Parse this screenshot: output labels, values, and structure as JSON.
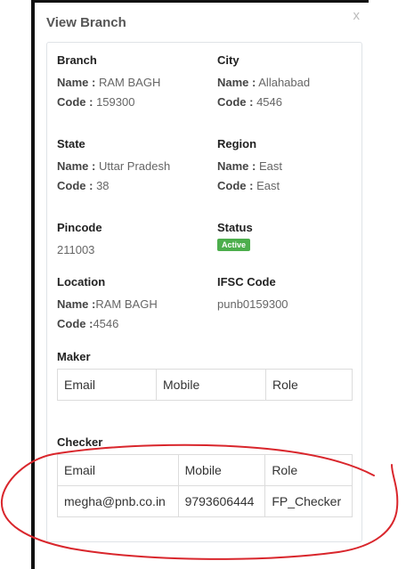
{
  "modal": {
    "title": "View Branch",
    "close": "x"
  },
  "branch": {
    "label": "Branch",
    "name_key": "Name :",
    "name_value": "RAM BAGH",
    "code_key": "Code :",
    "code_value": "159300"
  },
  "city": {
    "label": "City",
    "name_key": "Name :",
    "name_value": "Allahabad",
    "code_key": "Code :",
    "code_value": "4546"
  },
  "state": {
    "label": "State",
    "name_key": "Name :",
    "name_value": "Uttar Pradesh",
    "code_key": "Code :",
    "code_value": "38"
  },
  "region": {
    "label": "Region",
    "name_key": "Name :",
    "name_value": "East",
    "code_key": "Code :",
    "code_value": "East"
  },
  "pincode": {
    "label": "Pincode",
    "value": "211003"
  },
  "status": {
    "label": "Status",
    "badge": "Active",
    "badge_color": "#4cae4c"
  },
  "location": {
    "label": "Location",
    "name_key": "Name :",
    "name_value": "RAM BAGH",
    "code_key": "Code :",
    "code_value": "4546"
  },
  "ifsc": {
    "label": "IFSC Code",
    "value": "punb0159300"
  },
  "maker": {
    "label": "Maker",
    "headers": [
      "Email",
      "Mobile",
      "Role"
    ]
  },
  "checker": {
    "label": "Checker",
    "headers": [
      "Email",
      "Mobile",
      "Role"
    ],
    "rows": [
      [
        "megha@pnb.co.in",
        "9793606444",
        "FP_Checker"
      ]
    ]
  },
  "colors": {
    "annotation": "#d9262c",
    "panel_border": "#dfe3e7"
  }
}
